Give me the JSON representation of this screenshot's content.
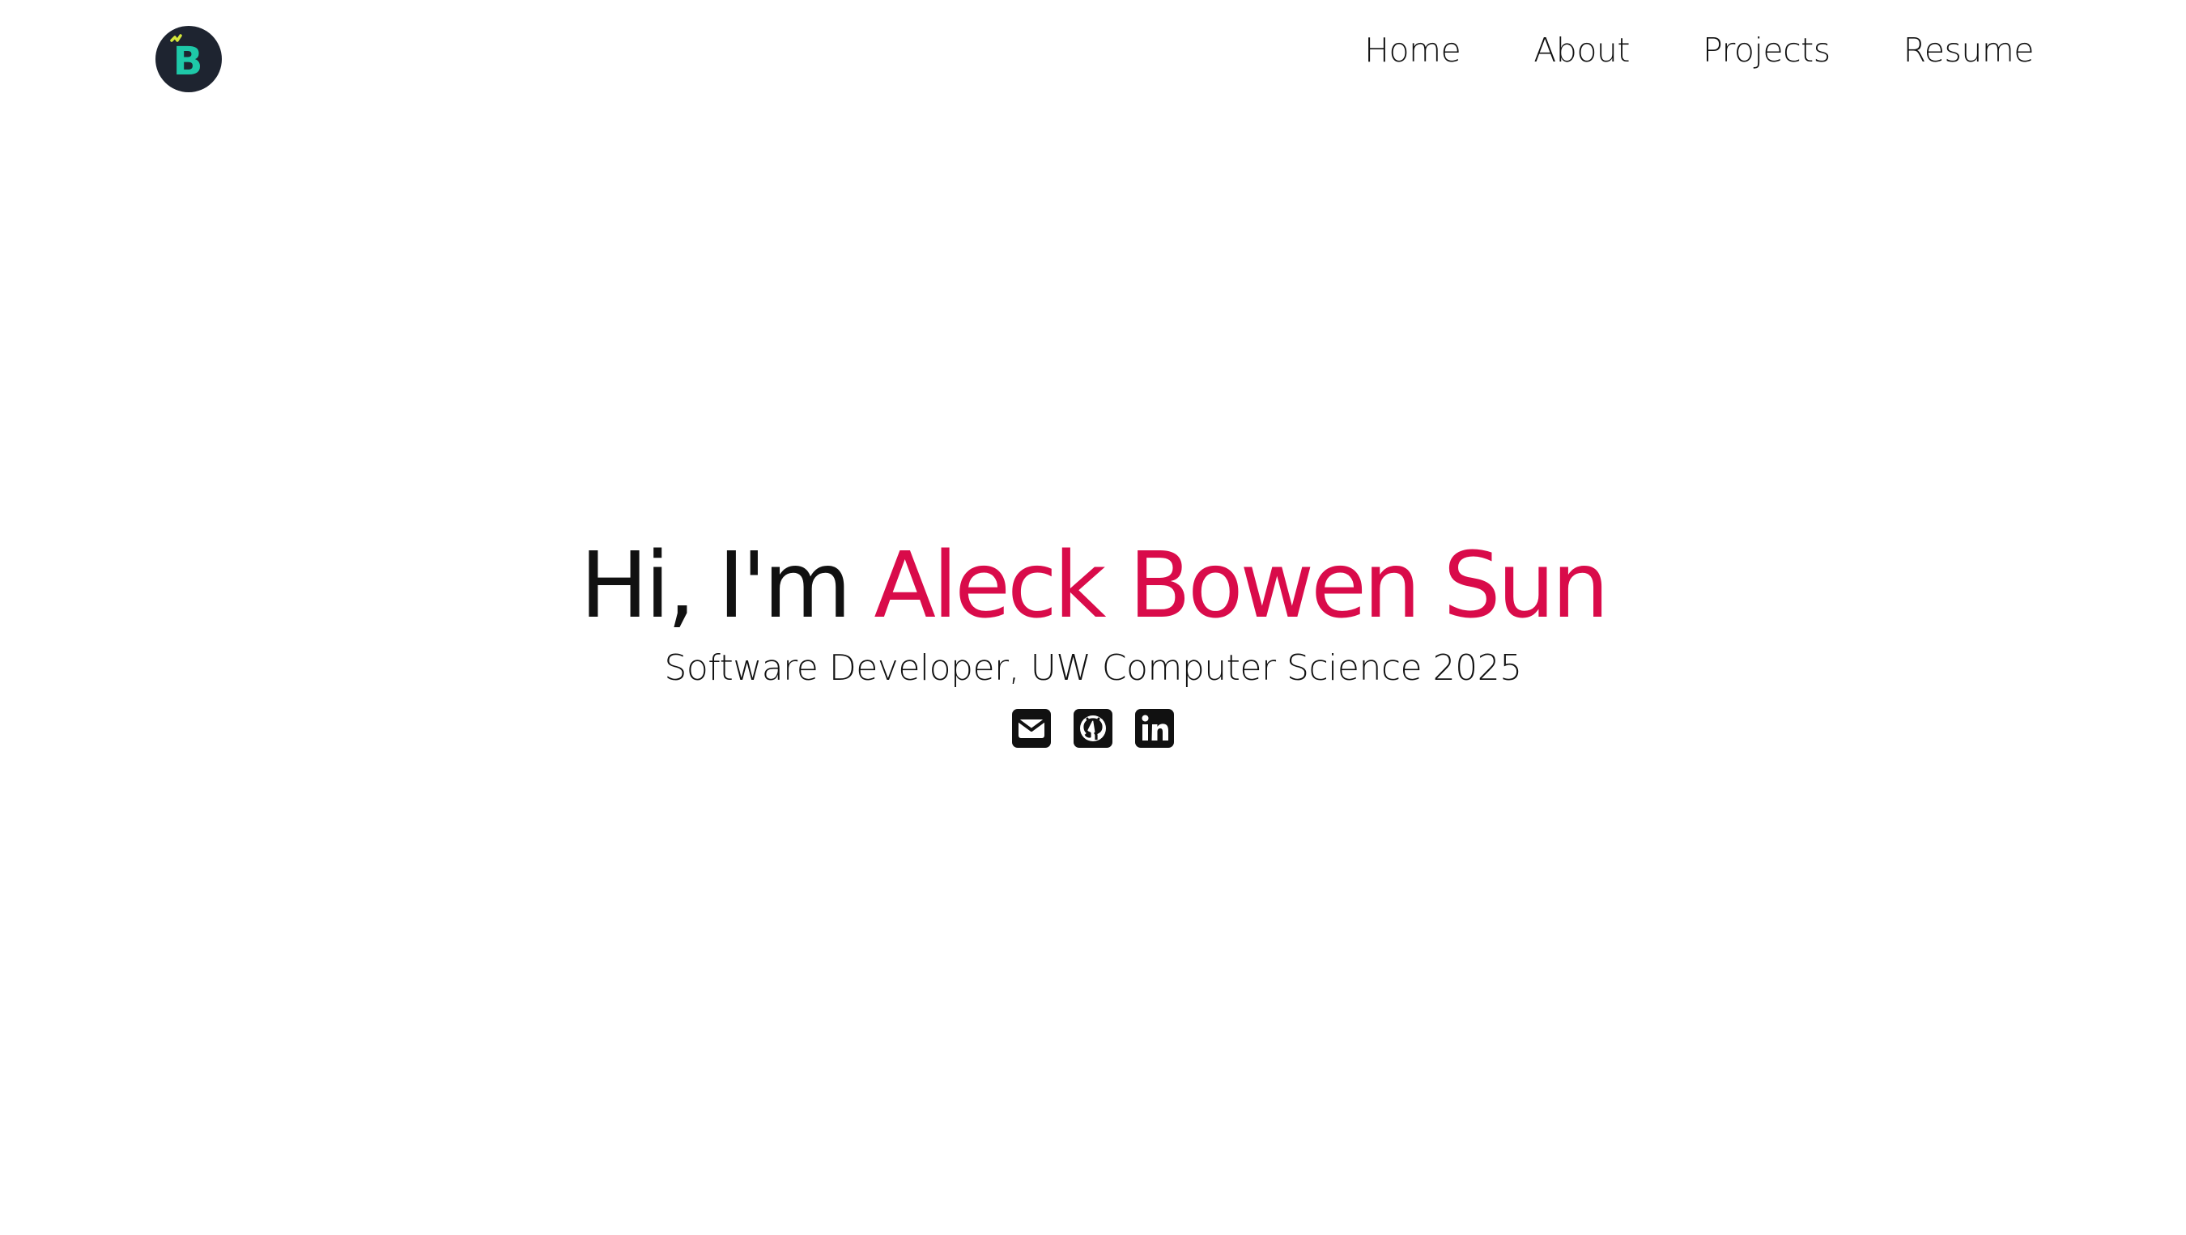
{
  "header": {
    "logo": {
      "letter": "B",
      "icon": "b-logo-icon",
      "bg_color": "#1e2430",
      "letter_color": "#1ec8a8",
      "accent_color": "#d6e83a"
    },
    "nav": [
      {
        "label": "Home"
      },
      {
        "label": "About"
      },
      {
        "label": "Projects"
      },
      {
        "label": "Resume"
      }
    ]
  },
  "hero": {
    "greeting": "Hi, I'm ",
    "name": "Aleck Bowen Sun",
    "name_color": "#d90b4a",
    "subtitle": "Software Developer, UW Computer Science 2025",
    "socials": [
      {
        "icon": "email-icon"
      },
      {
        "icon": "github-icon"
      },
      {
        "icon": "linkedin-icon"
      }
    ]
  }
}
